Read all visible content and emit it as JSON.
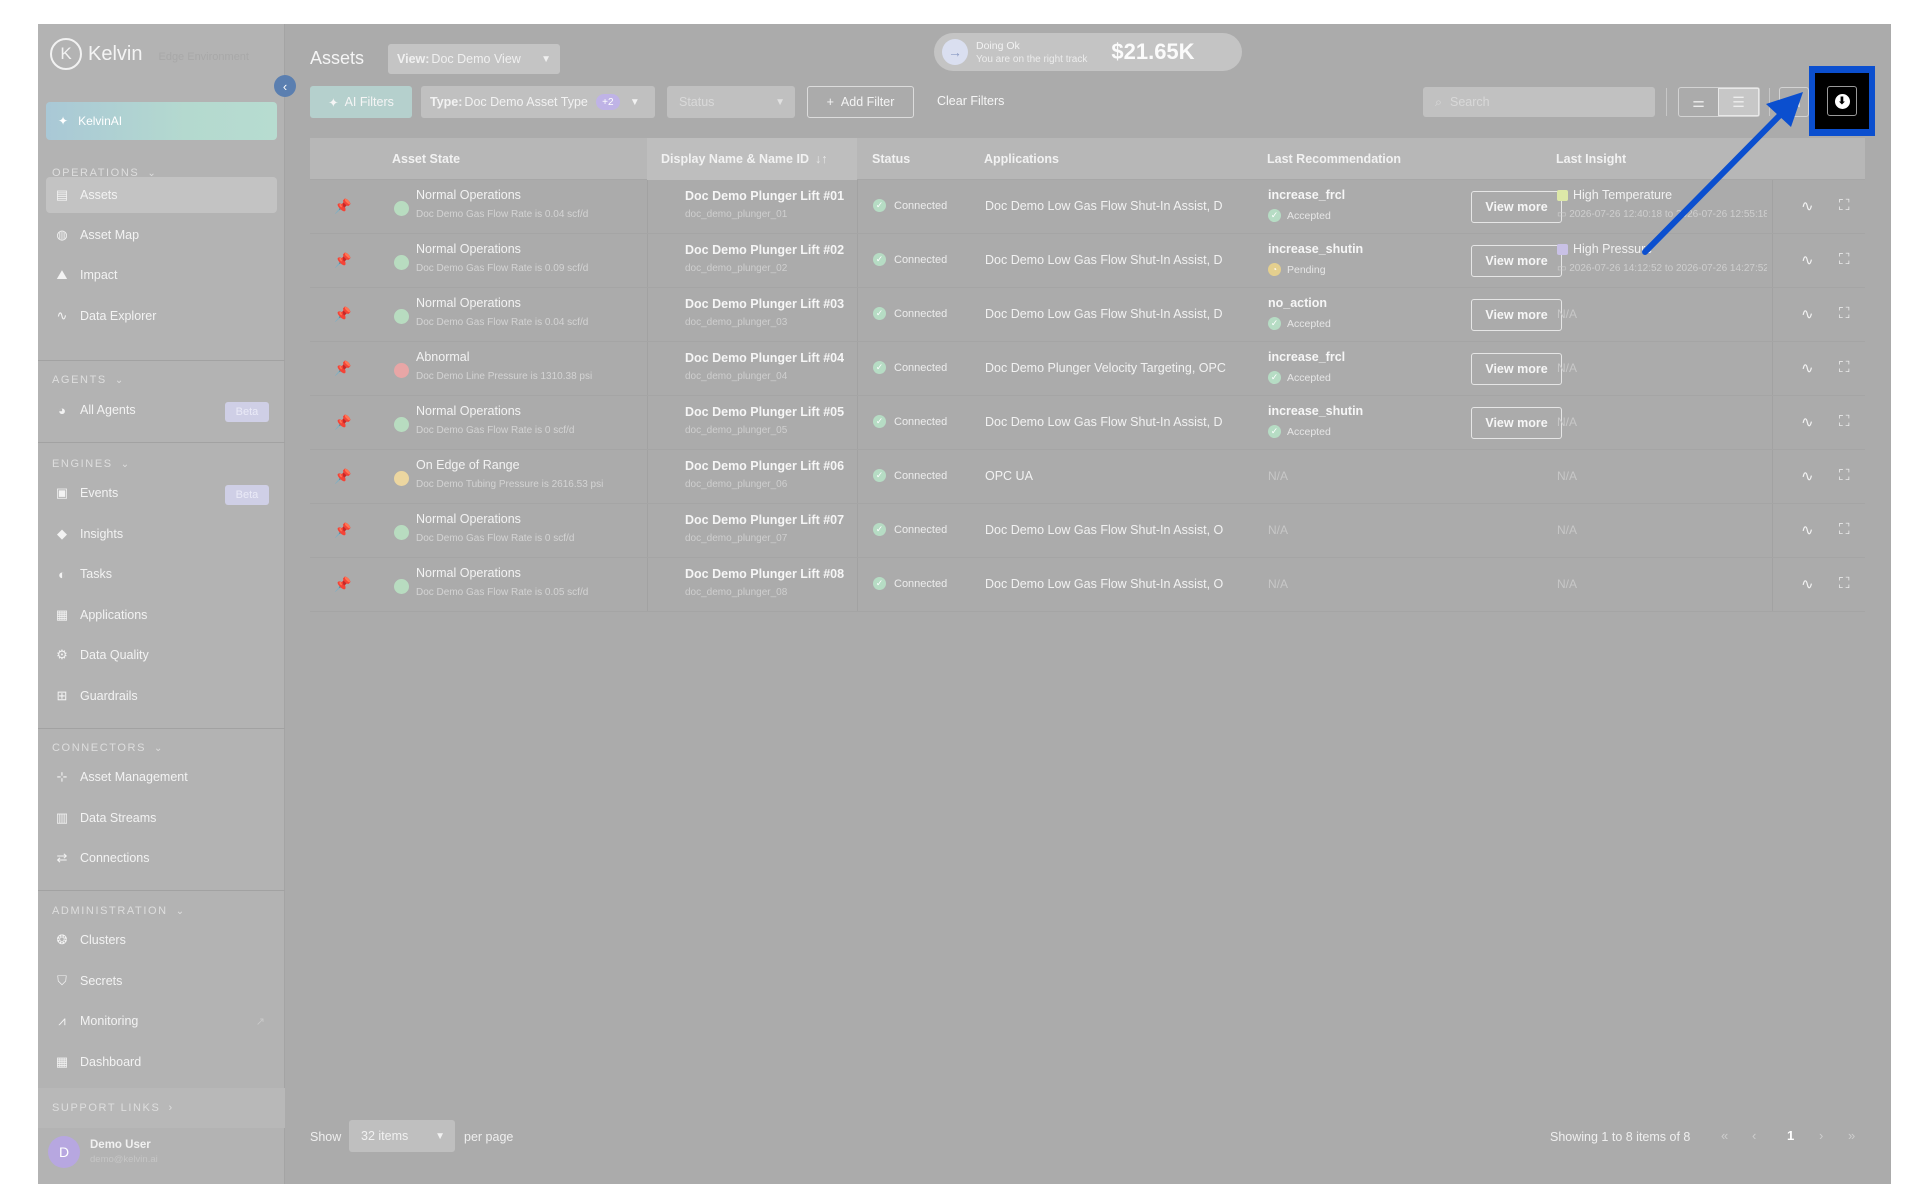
{
  "sidebar": {
    "brand": "Kelvin",
    "brand_sub": "Edge Environment",
    "kelvinai": "KelvinAI",
    "sections": {
      "operations": "OPERATIONS",
      "agents": "AGENTS",
      "engines": "ENGINES",
      "connectors": "CONNECTORS",
      "administration": "ADMINISTRATION",
      "support": "SUPPORT LINKS"
    },
    "items": {
      "assets": "Assets",
      "asset_map": "Asset Map",
      "impact": "Impact",
      "data_explorer": "Data Explorer",
      "all_agents": "All Agents",
      "events": "Events",
      "insights": "Insights",
      "tasks": "Tasks",
      "applications": "Applications",
      "data_quality": "Data Quality",
      "guardrails": "Guardrails",
      "asset_management": "Asset Management",
      "data_streams": "Data Streams",
      "connections": "Connections",
      "clusters": "Clusters",
      "secrets": "Secrets",
      "monitoring": "Monitoring",
      "dashboard": "Dashboard"
    },
    "beta_label": "Beta",
    "user": {
      "initial": "D",
      "name": "Demo User",
      "email": "demo@kelvin.ai"
    }
  },
  "header": {
    "title": "Assets",
    "view_prefix": "View:",
    "view_value": "Doc Demo View",
    "status_title": "Doing Ok",
    "status_sub": "You are on the right track",
    "amount": "$21.65K"
  },
  "filters": {
    "ai_filters": "AI Filters",
    "type_prefix": "Type:",
    "type_value": "Doc Demo Asset Type",
    "type_extra": "+2",
    "status_placeholder": "Status",
    "add_filter": "Add Filter",
    "clear_filters": "Clear Filters",
    "search_placeholder": "Search"
  },
  "table": {
    "headers": {
      "asset_state": "Asset State",
      "display_name": "Display Name & Name ID",
      "status": "Status",
      "applications": "Applications",
      "last_recommendation": "Last Recommendation",
      "last_insight": "Last Insight"
    },
    "view_more": "View more",
    "rows": [
      {
        "state": "Normal Operations",
        "state_sub": "Doc Demo Gas Flow Rate is 0.04 scf/d",
        "state_color": "#b8dcc0",
        "name": "Doc Demo Plunger Lift #01",
        "name_id": "doc_demo_plunger_01",
        "status": "Connected",
        "app": "Doc Demo Low Gas Flow Shut-In Assist, D",
        "rec": "increase_frcl",
        "rec_status": "Accepted",
        "rec_kind": "accepted",
        "insight": "High Temperature",
        "insight_color": "#dde8a8",
        "insight_sub": "2026-07-26 12:40:18 to 2026-07-26 12:55:18"
      },
      {
        "state": "Normal Operations",
        "state_sub": "Doc Demo Gas Flow Rate is 0.09 scf/d",
        "state_color": "#b8dcc0",
        "name": "Doc Demo Plunger Lift #02",
        "name_id": "doc_demo_plunger_02",
        "status": "Connected",
        "app": "Doc Demo Low Gas Flow Shut-In Assist, D",
        "rec": "increase_shutin",
        "rec_status": "Pending",
        "rec_kind": "pending",
        "insight": "High Pressure",
        "insight_color": "#c9c1e6",
        "insight_sub": "2026-07-26 14:12:52 to 2026-07-26 14:27:52"
      },
      {
        "state": "Normal Operations",
        "state_sub": "Doc Demo Gas Flow Rate is 0.04 scf/d",
        "state_color": "#b8dcc0",
        "name": "Doc Demo Plunger Lift #03",
        "name_id": "doc_demo_plunger_03",
        "status": "Connected",
        "app": "Doc Demo Low Gas Flow Shut-In Assist, D",
        "rec": "no_action",
        "rec_status": "Accepted",
        "rec_kind": "accepted",
        "insight": "",
        "insight_na": "N/A"
      },
      {
        "state": "Abnormal",
        "state_sub": "Doc Demo Line Pressure is 1310.38 psi",
        "state_color": "#e8a6a6",
        "name": "Doc Demo Plunger Lift #04",
        "name_id": "doc_demo_plunger_04",
        "status": "Connected",
        "app": "Doc Demo Plunger Velocity Targeting, OPC",
        "rec": "increase_frcl",
        "rec_status": "Accepted",
        "rec_kind": "accepted",
        "insight": "",
        "insight_na": "N/A"
      },
      {
        "state": "Normal Operations",
        "state_sub": "Doc Demo Gas Flow Rate is 0 scf/d",
        "state_color": "#b8dcc0",
        "name": "Doc Demo Plunger Lift #05",
        "name_id": "doc_demo_plunger_05",
        "status": "Connected",
        "app": "Doc Demo Low Gas Flow Shut-In Assist, D",
        "rec": "increase_shutin",
        "rec_status": "Accepted",
        "rec_kind": "accepted",
        "insight": "",
        "insight_na": "N/A"
      },
      {
        "state": "On Edge of Range",
        "state_sub": "Doc Demo Tubing Pressure is 2616.53 psi",
        "state_color": "#ecd6a0",
        "name": "Doc Demo Plunger Lift #06",
        "name_id": "doc_demo_plunger_06",
        "status": "Connected",
        "app": "OPC UA",
        "rec": "",
        "rec_na": "N/A",
        "insight": "",
        "insight_na": "N/A"
      },
      {
        "state": "Normal Operations",
        "state_sub": "Doc Demo Gas Flow Rate is 0 scf/d",
        "state_color": "#b8dcc0",
        "name": "Doc Demo Plunger Lift #07",
        "name_id": "doc_demo_plunger_07",
        "status": "Connected",
        "app": "Doc Demo Low Gas Flow Shut-In Assist, O",
        "rec": "",
        "rec_na": "N/A",
        "insight": "",
        "insight_na": "N/A"
      },
      {
        "state": "Normal Operations",
        "state_sub": "Doc Demo Gas Flow Rate is 0.05 scf/d",
        "state_color": "#b8dcc0",
        "name": "Doc Demo Plunger Lift #08",
        "name_id": "doc_demo_plunger_08",
        "status": "Connected",
        "app": "Doc Demo Low Gas Flow Shut-In Assist, O",
        "rec": "",
        "rec_na": "N/A",
        "insight": "",
        "insight_na": "N/A"
      }
    ]
  },
  "footer": {
    "show": "Show",
    "page_size": "32 items",
    "per_page": "per page",
    "showing": "Showing 1 to 8 items of 8",
    "current_page": "1"
  },
  "annotation": {
    "arrow_color": "#0b4fcf",
    "highlight": "download-button"
  }
}
